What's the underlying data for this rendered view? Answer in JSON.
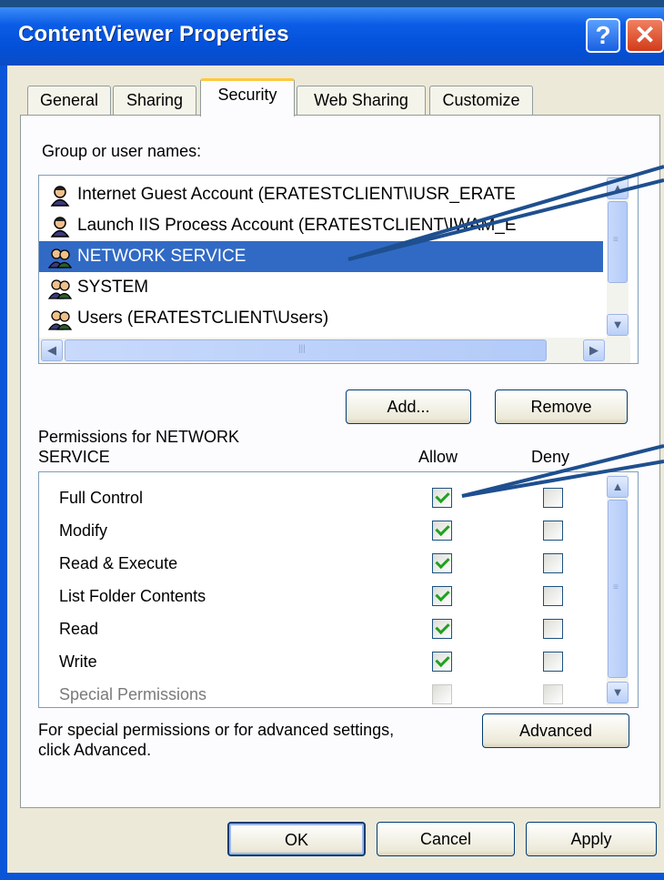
{
  "window": {
    "title": "ContentViewer Properties",
    "help_label": "?",
    "close_label": "✕"
  },
  "tabs": [
    {
      "label": "General"
    },
    {
      "label": "Sharing"
    },
    {
      "label": "Security"
    },
    {
      "label": "Web Sharing"
    },
    {
      "label": "Customize"
    }
  ],
  "groups": {
    "label": "Group or user names:",
    "items": [
      {
        "name": "Internet Guest Account (ERATESTCLIENT\\IUSR_ERATE",
        "icon": "user-icon"
      },
      {
        "name": "Launch IIS Process Account (ERATESTCLIENT\\IWAM_E",
        "icon": "user-icon"
      },
      {
        "name": "NETWORK SERVICE",
        "icon": "group-icon"
      },
      {
        "name": "SYSTEM",
        "icon": "group-icon"
      },
      {
        "name": "Users (ERATESTCLIENT\\Users)",
        "icon": "group-icon"
      }
    ],
    "selected": "NETWORK SERVICE"
  },
  "buttons": {
    "add": "Add...",
    "remove": "Remove",
    "advanced": "Advanced",
    "ok": "OK",
    "cancel": "Cancel",
    "apply": "Apply"
  },
  "permissions": {
    "label_line1": "Permissions for NETWORK",
    "label_line2": "SERVICE",
    "allow_header": "Allow",
    "deny_header": "Deny",
    "rows": [
      {
        "name": "Full Control",
        "allow": true,
        "deny": false
      },
      {
        "name": "Modify",
        "allow": true,
        "deny": false
      },
      {
        "name": "Read & Execute",
        "allow": true,
        "deny": false
      },
      {
        "name": "List Folder Contents",
        "allow": true,
        "deny": false
      },
      {
        "name": "Read",
        "allow": true,
        "deny": false
      },
      {
        "name": "Write",
        "allow": true,
        "deny": false
      },
      {
        "name": "Special Permissions",
        "allow": false,
        "deny": false
      }
    ]
  },
  "advanced_text": {
    "line1": "For special permissions or for advanced settings,",
    "line2": "click Advanced."
  },
  "colors": {
    "selection": "#316ac5",
    "titlebar": "#0350d8",
    "annotation_arrow": "#1e4f8f"
  }
}
